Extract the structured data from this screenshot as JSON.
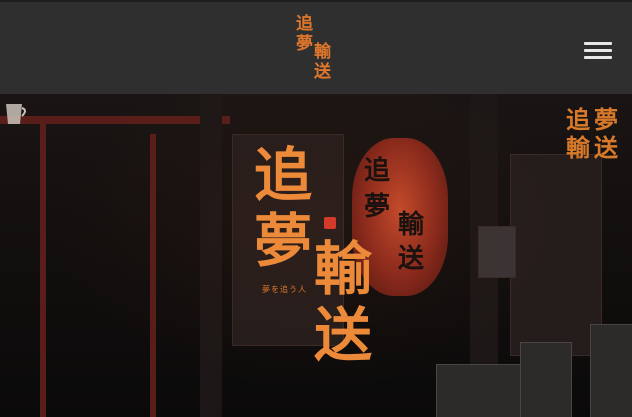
{
  "header": {
    "logo_chars": [
      "追",
      "夢",
      "輸",
      "送"
    ],
    "menu_icon": "hamburger-menu-icon"
  },
  "hero": {
    "title_chars": [
      "追",
      "夢",
      "輸",
      "送"
    ],
    "subtitle": "夢を追う人",
    "lantern_chars": [
      "追",
      "夢",
      "輸",
      "送"
    ],
    "sign_chars": [
      "追",
      "夢",
      "輸",
      "送"
    ],
    "colors": {
      "accent": "#e0782c",
      "header_bg": "#2f2f2f",
      "lantern": "#c44a2a"
    }
  }
}
